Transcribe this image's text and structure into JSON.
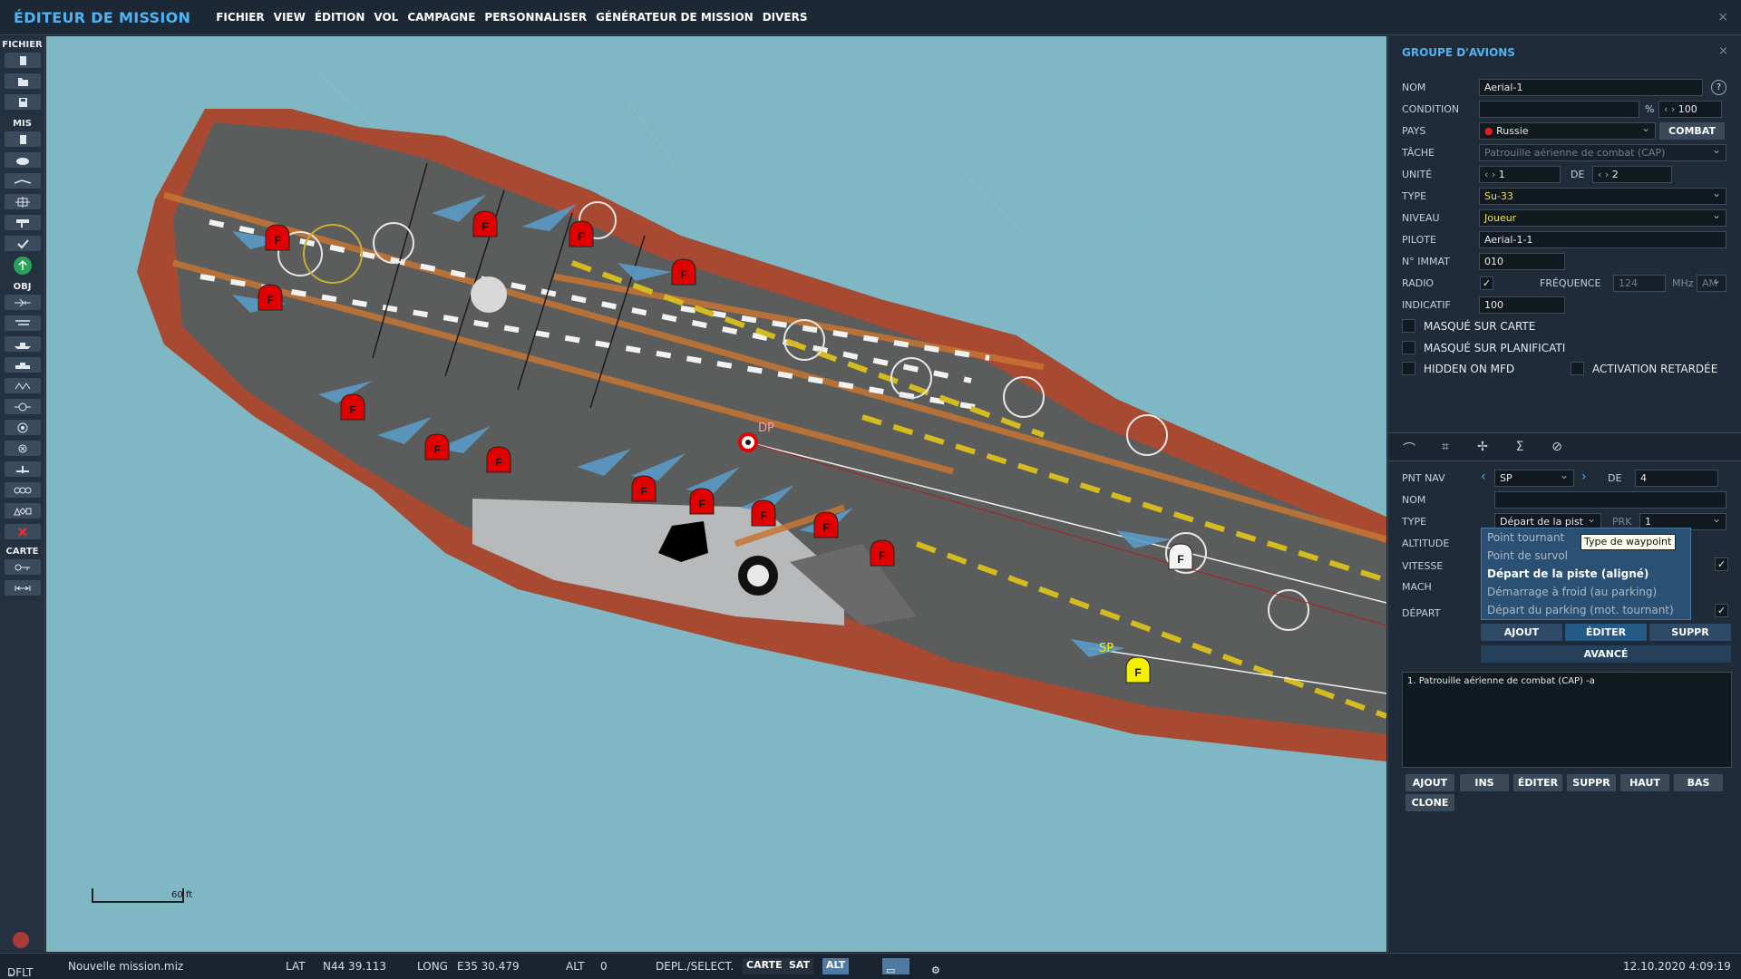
{
  "app": {
    "title": "ÉDITEUR DE MISSION",
    "menu": [
      "FICHIER",
      "VIEW",
      "ÉDITION",
      "VOL",
      "CAMPAGNE",
      "PERSONNALISER",
      "GÉNÉRATEUR DE MISSION",
      "DIVERS"
    ]
  },
  "toolbar": {
    "sections": [
      "FICHIER",
      "MIS",
      "OBJ",
      "CARTE"
    ]
  },
  "map": {
    "scale_label": "60 ft",
    "waypoints": {
      "dp": "DP",
      "sp": "SP"
    },
    "unit_letter": "F",
    "colors": {
      "red_unit": "#e00000",
      "white_unit": "#f4f4f4",
      "yellow_unit": "#f3f000",
      "sea": "#7fb8c4",
      "deck": "#5a5a5a",
      "hull": "#a84a32"
    }
  },
  "panel": {
    "title": "GROUPE D'AVIONS",
    "fields": {
      "nom_label": "NOM",
      "nom_value": "Aerial-1",
      "condition_label": "CONDITION",
      "condition_unit": "%",
      "condition_value": "100",
      "pays_label": "PAYS",
      "pays_value": "Russie",
      "combat_button": "COMBAT",
      "tache_label": "TÂCHE",
      "tache_value": "Patrouille aérienne de combat (CAP)",
      "unite_label": "UNITÉ",
      "unite_value": "1",
      "unite_de": "DE",
      "unite_total": "2",
      "type_label": "TYPE",
      "type_value": "Su-33",
      "niveau_label": "NIVEAU",
      "niveau_value": "Joueur",
      "pilote_label": "PILOTE",
      "pilote_value": "Aerial-1-1",
      "immat_label": "N° IMMAT",
      "immat_value": "010",
      "radio_label": "RADIO",
      "radio_checked": "✓",
      "frequence_label": "FRÉQUENCE",
      "frequence_value": "124",
      "frequence_unit": "MHz",
      "modulation": "AM",
      "indicatif_label": "INDICATIF",
      "indicatif_value": "100"
    },
    "checkboxes": {
      "masque_carte": "MASQUÉ SUR CARTE",
      "masque_planif": "MASQUÉ SUR PLANIFICATI",
      "hidden_mfd": "HIDDEN ON MFD",
      "activation": "ACTIVATION RETARDÉE"
    },
    "help": "?",
    "close": "×",
    "tabs": [
      "route",
      "triggered",
      "payload",
      "summary",
      "failures"
    ],
    "waypoint": {
      "pnt_nav_label": "PNT NAV",
      "pnt_nav_value": "SP",
      "de_label": "DE",
      "de_value": "4",
      "nom_label": "NOM",
      "nom_value": "",
      "type_label": "TYPE",
      "type_value": "Départ de la pist",
      "prk_label": "PRK",
      "prk_value": "1",
      "altitude_label": "ALTITUDE",
      "vitesse_label": "VITESSE",
      "mach_label": "MACH",
      "depart_label": "DÉPART",
      "checked": "✓"
    },
    "type_options": [
      "Point tournant",
      "Point de survol",
      "Départ de la piste (aligné)",
      "Démarrage à froid (au parking)",
      "Départ du parking (mot. tournant)"
    ],
    "tooltip": "Type de waypoint",
    "wp_buttons": {
      "ajout": "AJOUT",
      "editer": "ÉDITER",
      "suppr": "SUPPR",
      "avance": "AVANCÉ"
    },
    "task_list": [
      "1. Patrouille aérienne de combat (CAP) -a"
    ],
    "task_buttons": [
      "AJOUT",
      "INS",
      "ÉDITER",
      "SUPPR",
      "HAUT",
      "BAS",
      "CLONE"
    ]
  },
  "status": {
    "profile": "DFLT",
    "file": "Nouvelle mission.miz",
    "lat_label": "LAT",
    "lat_value": "N44 39.113",
    "long_label": "LONG",
    "long_value": "E35 30.479",
    "alt_label": "ALT",
    "alt_value": "0",
    "mode": "DEPL./SELECT.",
    "map_modes": [
      "CARTE",
      "SAT",
      "ALT"
    ],
    "datetime": "12.10.2020 4:09:19"
  }
}
